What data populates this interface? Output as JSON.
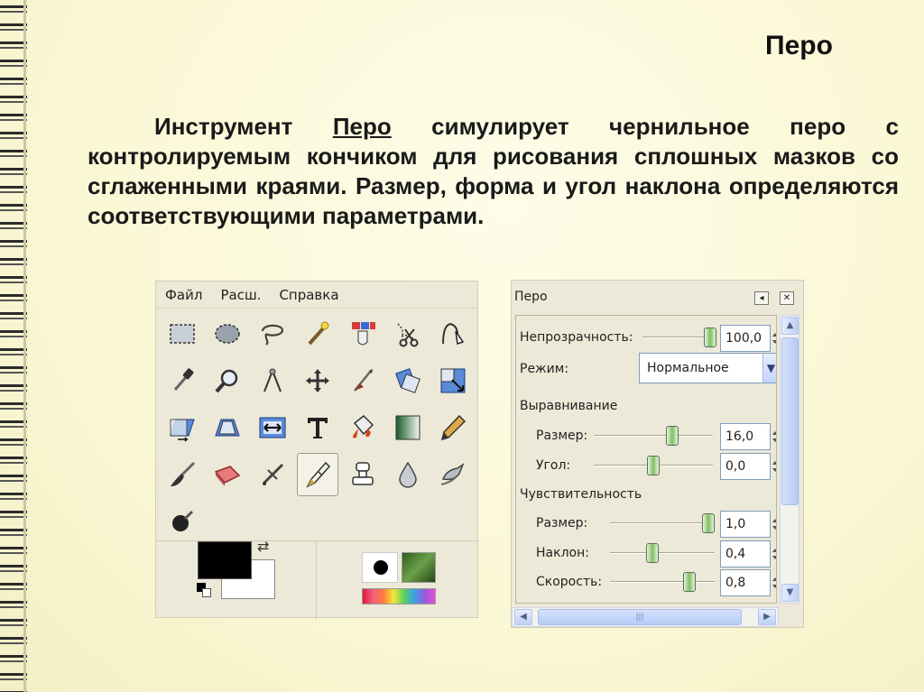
{
  "slide": {
    "title": "Перо",
    "body_before": "Инструмент ",
    "body_link": "Перо",
    "body_after": " симулирует чернильное перо с контролируемым кончиком для рисования сплошных мазков со сглаженными краями. Размер, форма и угол наклона определяются соответствующими параметрами."
  },
  "toolbox": {
    "menu": [
      "Файл",
      "Расш.",
      "Справка"
    ],
    "tools": [
      "rect-select-icon",
      "ellipse-select-icon",
      "lasso-icon",
      "fuzzy-select-icon",
      "select-by-color-icon",
      "scissors-icon",
      "foreground-select-icon",
      "paths-icon",
      "color-picker-icon",
      "zoom-icon",
      "measure-icon",
      "move-icon",
      "crop-icon",
      "rotate-icon",
      "scale-icon",
      "shear-icon",
      "perspective-icon",
      "flip-icon",
      "text-icon",
      "bucket-fill-icon",
      "blend-icon",
      "pencil-icon",
      "paintbrush-icon",
      "eraser-icon",
      "airbrush-icon",
      "ink-icon",
      "clone-icon",
      "heal-icon",
      "perspective-clone-icon",
      "blur-icon",
      "smudge-icon",
      "dodge-burn-icon"
    ]
  },
  "options": {
    "title": "Перо",
    "opacity_label": "Непрозрачность:",
    "opacity_value": "100,0",
    "mode_label": "Режим:",
    "mode_value": "Нормальное",
    "adjust_label": "Выравнивание",
    "adj_size_label": "Размер:",
    "adj_size_value": "16,0",
    "angle_label": "Угол:",
    "angle_value": "0,0",
    "sens_label": "Чувствительность",
    "sens_size_label": "Размер:",
    "sens_size_value": "1,0",
    "tilt_label": "Наклон:",
    "tilt_value": "0,4",
    "speed_label": "Скорость:",
    "speed_value": "0,8"
  }
}
